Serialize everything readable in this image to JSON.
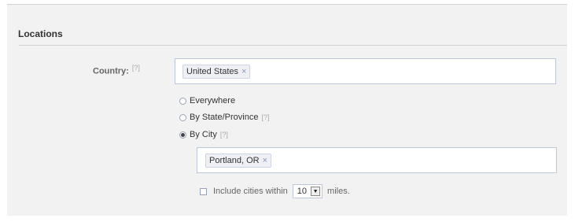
{
  "section": {
    "title": "Locations"
  },
  "country": {
    "label": "Country:",
    "help": "[?]",
    "token": "United States",
    "token_remove": "×"
  },
  "location_options": [
    {
      "label": "Everywhere",
      "help": "",
      "checked": false
    },
    {
      "label": "By State/Province",
      "help": "[?]",
      "checked": false
    },
    {
      "label": "By City",
      "help": "[?]",
      "checked": true
    }
  ],
  "city": {
    "token": "Portland, OR",
    "token_remove": "×"
  },
  "include": {
    "label_before": "Include cities within",
    "value": "10",
    "label_after": "miles.",
    "checked": false
  }
}
